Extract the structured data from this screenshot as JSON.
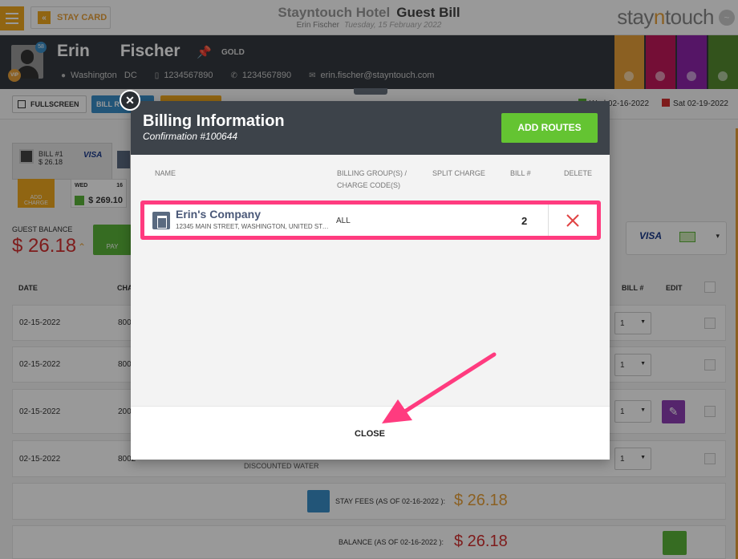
{
  "header": {
    "stay_card_label": "STAY CARD",
    "hotel_name": "Stayntouch Hotel",
    "page_title": "Guest Bill",
    "guest_name": "Erin Fischer",
    "date": "Tuesday, 15 February 2022",
    "brand_pre": "stay",
    "brand_n": "n",
    "brand_post": "touch"
  },
  "guest": {
    "first_name": "Erin",
    "last_name": "Fischer",
    "membership": "GOLD",
    "city": "Washington",
    "state": "DC",
    "phone1": "1234567890",
    "phone2": "1234567890",
    "email": "erin.fischer@stayntouch.com",
    "vip_label": "VIP",
    "badge_count": "58"
  },
  "toolbar": {
    "fullscreen_label": "FULLSCREEN",
    "bill_routing_label": "BILL R",
    "arrival_date": "Wed 02-16-2022",
    "departure_date": "Sat 02-19-2022"
  },
  "bill_card": {
    "title": "BILL #1",
    "amount": "$ 26.18",
    "card_brand": "VISA",
    "add_charge_label": "ADD CHARGE",
    "day": "WED",
    "day_num": "16",
    "day_amount": "$ 269.10"
  },
  "balance": {
    "label": "GUEST BALANCE",
    "value": "$ 26.18",
    "pay_label": "PAY",
    "card_brand": "VISA"
  },
  "table": {
    "headers": {
      "date": "DATE",
      "charge": "CHA",
      "bill": "BILL #",
      "edit": "EDIT"
    },
    "rows": [
      {
        "date": "02-15-2022",
        "code": "800",
        "bill": "1"
      },
      {
        "date": "02-15-2022",
        "code": "800",
        "bill": "1"
      },
      {
        "date": "02-15-2022",
        "code": "200",
        "bill": "1"
      },
      {
        "date": "02-15-2022",
        "code": "8002",
        "bill": "1"
      }
    ],
    "discount_text": "DISCOUNTED WATER"
  },
  "totals": {
    "stay_fees_label": "STAY FEES (AS OF 02-16-2022 ):",
    "stay_fees_value": "$ 26.18",
    "balance_label": "BALANCE (AS OF 02-16-2022 ):",
    "balance_value": "$ 26.18"
  },
  "modal": {
    "title": "Billing Information",
    "subtitle": "Confirmation #100644",
    "add_routes_label": "ADD ROUTES",
    "columns": {
      "name": "NAME",
      "billing_group_1": "BILLING GROUP(S) /",
      "billing_group_2": "CHARGE CODE(S)",
      "split_charge": "SPLIT CHARGE",
      "bill_no": "BILL #",
      "delete": "DELETE"
    },
    "route": {
      "name": "Erin's Company",
      "address": "12345 MAIN STREET, WASHINGTON, UNITED STATES",
      "group": "ALL",
      "bill": "2"
    },
    "close_label": "CLOSE"
  },
  "colors": {
    "accent_orange": "#f0a81e",
    "highlight_pink": "#ff3b7f",
    "add_routes_green": "#64c432",
    "header_dark": "#3d434a",
    "balance_red": "#d32f2f"
  }
}
